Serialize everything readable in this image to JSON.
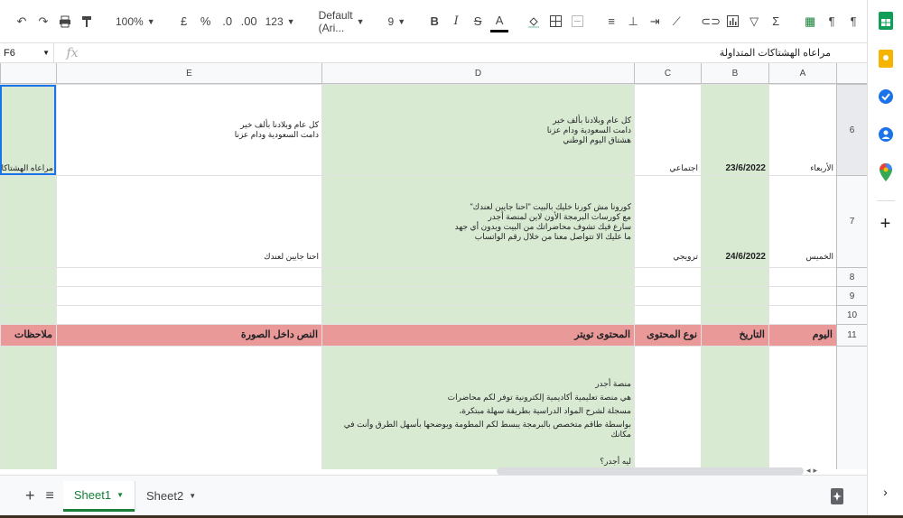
{
  "toolbar": {
    "zoom": "100%",
    "currency": "£",
    "percent": "%",
    "dec_decrease": ".0",
    "dec_increase": ".00",
    "format_more": "123",
    "font": "Default (Ari...",
    "font_size": "9",
    "bold": "B",
    "italic": "I",
    "strike": "S",
    "text_color": "A"
  },
  "formula": {
    "cell_ref": "F6",
    "fx": "fx",
    "content": "مراعاه الهشتاكات المتداولة"
  },
  "columns": [
    "E",
    "D",
    "C",
    "B",
    "A"
  ],
  "rows": {
    "r6": {
      "num": "6",
      "f": "مراعاه الهشتاكات المتد",
      "e": [
        "كل عام وبلادنا بألف خير",
        "دامت السعودية ودام عزنا"
      ],
      "d": [
        "كل عام وبلادنا بألف خير",
        "دامت السعودية ودام عزنا",
        "هشتاق اليوم الوطني"
      ],
      "c": "اجتماعي",
      "b": "23/6/2022",
      "a": "الأربعاء"
    },
    "r7": {
      "num": "7",
      "e": "احنا جايين لعندك",
      "d": [
        "كورونا مش كورنا خليك بالبيت \"احنا جايين لعندك\"",
        "مع كورسات البرمجة الأون لاين لمنصة أجدر",
        "سارع فيك تشوف محاضراتك من البيت وبدون أي جهد",
        "ما عليك الا تتواصل معنا من خلال رقم الواتساب"
      ],
      "c": "ترويجي",
      "b": "24/6/2022",
      "a": "الخميس"
    },
    "r8": {
      "num": "8"
    },
    "r9": {
      "num": "9"
    },
    "r10": {
      "num": "10"
    },
    "r11": {
      "num": "11",
      "f": "ملاحظات",
      "e": "النص داخل الصورة",
      "d": "المحتوى تويتر",
      "c": "نوع المحتوى",
      "b": "التاريخ",
      "a": "اليوم"
    },
    "r12": {
      "d": [
        "منصة أجدر",
        "هي منصة تعليمية أكاديمية إلكترونية توفر لكم محاضرات",
        "مسجلة لشرح المواد الدراسية بطريقة سهلة مبتكرة،",
        "بواسطة طاقم متخصص بالبرمجة يبسط لكم المطومة ويوضحها بأسهل الطرق وأنت في مكانك",
        "",
        "ليه أجدر؟"
      ]
    }
  },
  "tabs": {
    "add": "+",
    "all": "≡",
    "sheet1": "Sheet1",
    "sheet2": "Sheet2"
  },
  "colors": {
    "green": "#d9ead3",
    "pink": "#ea9999",
    "accent": "#188038"
  }
}
